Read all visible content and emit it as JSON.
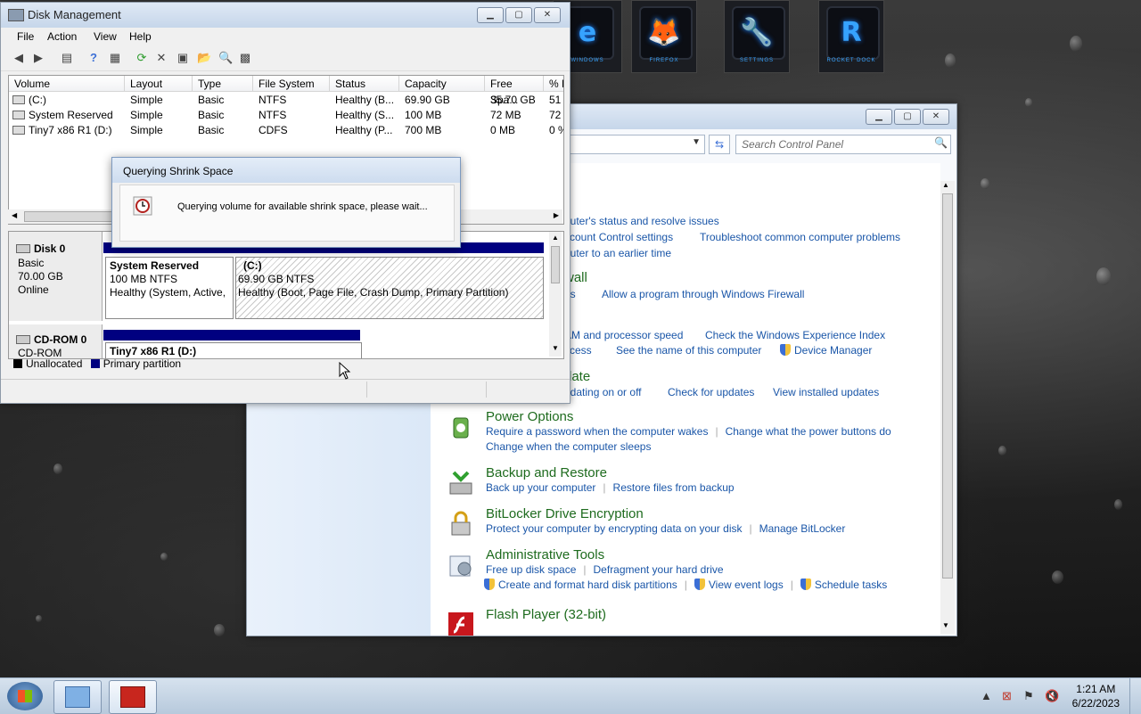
{
  "disk_management": {
    "title": "Disk Management",
    "menu": [
      "File",
      "Action",
      "View",
      "Help"
    ],
    "columns": [
      "Volume",
      "Layout",
      "Type",
      "File System",
      "Status",
      "Capacity",
      "Free Spa...",
      "% F"
    ],
    "rows": [
      [
        "(C:)",
        "Simple",
        "Basic",
        "NTFS",
        "Healthy (B...",
        "69.90 GB",
        "35.70 GB",
        "51"
      ],
      [
        "System Reserved",
        "Simple",
        "Basic",
        "NTFS",
        "Healthy (S...",
        "100 MB",
        "72 MB",
        "72"
      ],
      [
        "Tiny7 x86 R1 (D:)",
        "Simple",
        "Basic",
        "CDFS",
        "Healthy (P...",
        "700 MB",
        "0 MB",
        "0 %"
      ]
    ],
    "disk0": {
      "name": "Disk 0",
      "type": "Basic",
      "size": "70.00 GB",
      "state": "Online",
      "part1": {
        "name": "System Reserved",
        "size": "100 MB NTFS",
        "status": "Healthy (System, Active,"
      },
      "part2": {
        "name": "(C:)",
        "size": "69.90 GB NTFS",
        "status": "Healthy (Boot, Page File, Crash Dump, Primary Partition)"
      }
    },
    "cdrom0": {
      "name": "CD-ROM 0",
      "type": "CD-ROM",
      "part": {
        "name": "Tiny7 x86 R1  (D:)"
      }
    },
    "legend": {
      "unallocated": "Unallocated",
      "primary": "Primary partition"
    },
    "colors": {
      "unallocated": "#000000",
      "primary": "#000080"
    }
  },
  "dialog": {
    "title": "Querying Shrink Space",
    "message": "Querying volume for available shrink space, please wait..."
  },
  "control_panel": {
    "search_placeholder": "Search Control Panel",
    "partial_lines": {
      "l1": "puter's status and resolve issues",
      "l2a": "ccount Control settings",
      "l2b": "Troubleshoot common computer problems",
      "l3": "puter to an earlier time",
      "firewall_head": "wall",
      "l4a": "us",
      "l4b": "Allow a program through Windows Firewall",
      "l5a": "AM and processor speed",
      "l5b": "Check the Windows Experience Index",
      "l6a": "ccess",
      "l6b": "See the name of this computer",
      "l6c": "Device Manager",
      "update_head": "date",
      "l7a": "pdating on or off",
      "l7b": "Check for updates",
      "l7c": "View installed updates"
    },
    "categories": {
      "power": {
        "title": "Power Options",
        "links": [
          "Require a password when the computer wakes",
          "Change what the power buttons do",
          "Change when the computer sleeps"
        ]
      },
      "backup": {
        "title": "Backup and Restore",
        "links": [
          "Back up your computer",
          "Restore files from backup"
        ]
      },
      "bitlocker": {
        "title": "BitLocker Drive Encryption",
        "links": [
          "Protect your computer by encrypting data on your disk",
          "Manage BitLocker"
        ]
      },
      "admin": {
        "title": "Administrative Tools",
        "links": [
          "Free up disk space",
          "Defragment your hard drive",
          "Create and format hard disk partitions",
          "View event logs",
          "Schedule tasks"
        ]
      },
      "flash": {
        "title": "Flash Player (32-bit)"
      }
    },
    "link_color": "#1a56a8",
    "heading_color": "#1e6b1e"
  },
  "dock": [
    {
      "glyph": "e",
      "caption": "WINDOWS"
    },
    {
      "glyph": "🦊",
      "caption": "FIREFOX"
    },
    {
      "glyph": "🔧",
      "caption": "SETTINGS"
    },
    {
      "glyph": "R",
      "caption": "ROCKET DOCK"
    }
  ],
  "taskbar": {
    "time": "1:21 AM",
    "date": "6/22/2023"
  }
}
